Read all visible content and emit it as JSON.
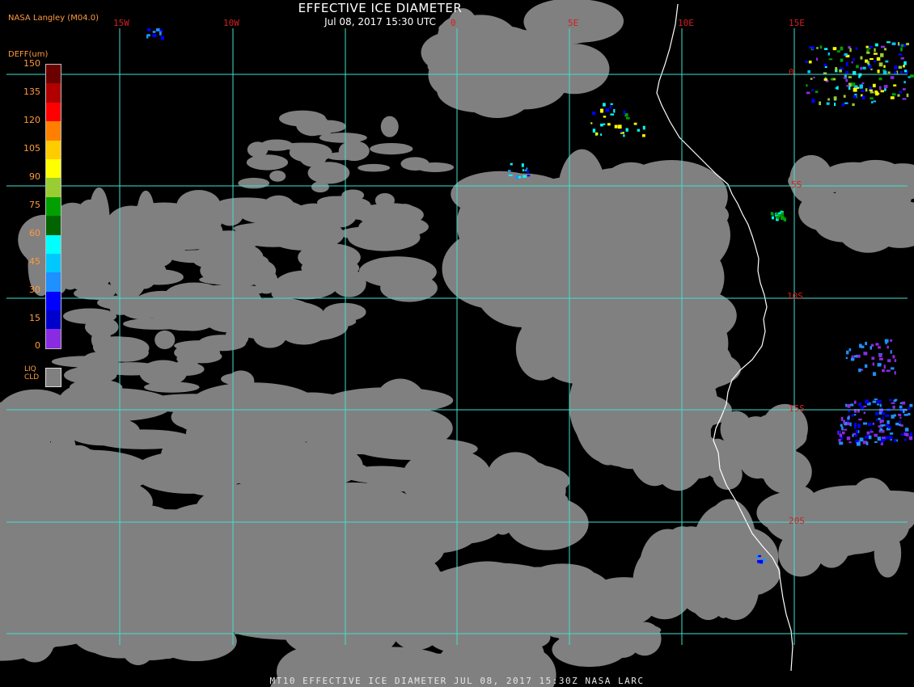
{
  "header": {
    "title": "EFFECTIVE ICE DIAMETER",
    "subtitle": "Jul 08, 2017 15:30 UTC",
    "brand": "NASA Langley (M04.0)"
  },
  "grid": {
    "lon_labels": [
      "15W",
      "10W",
      "0",
      "5E",
      "10E",
      "15E"
    ],
    "lat_labels": [
      "0",
      "5S",
      "10S",
      "15S",
      "20S"
    ]
  },
  "legend": {
    "title": "DEFF(um)",
    "ticks": [
      "150",
      "135",
      "120",
      "105",
      "90",
      "75",
      "60",
      "45",
      "30",
      "15",
      "0"
    ],
    "colors": [
      "#6b0000",
      "#b00000",
      "#ff0000",
      "#ff7f00",
      "#ffcc00",
      "#ffff00",
      "#9acd32",
      "#00a000",
      "#006400",
      "#00ffff",
      "#00c8ff",
      "#1e90ff",
      "#0000ff",
      "#0000cd",
      "#8a2be2"
    ],
    "liq_label_1": "LIQ",
    "liq_label_2": "CLD",
    "liq_color": "#808080"
  },
  "colors": {
    "grid": "#40e0d0",
    "coast": "#ffffff",
    "cloud": "#808080",
    "background": "#000000"
  },
  "footer": "MT10  EFFECTIVE ICE DIAMETER   JUL 08, 2017 15:30Z   NASA LARC"
}
